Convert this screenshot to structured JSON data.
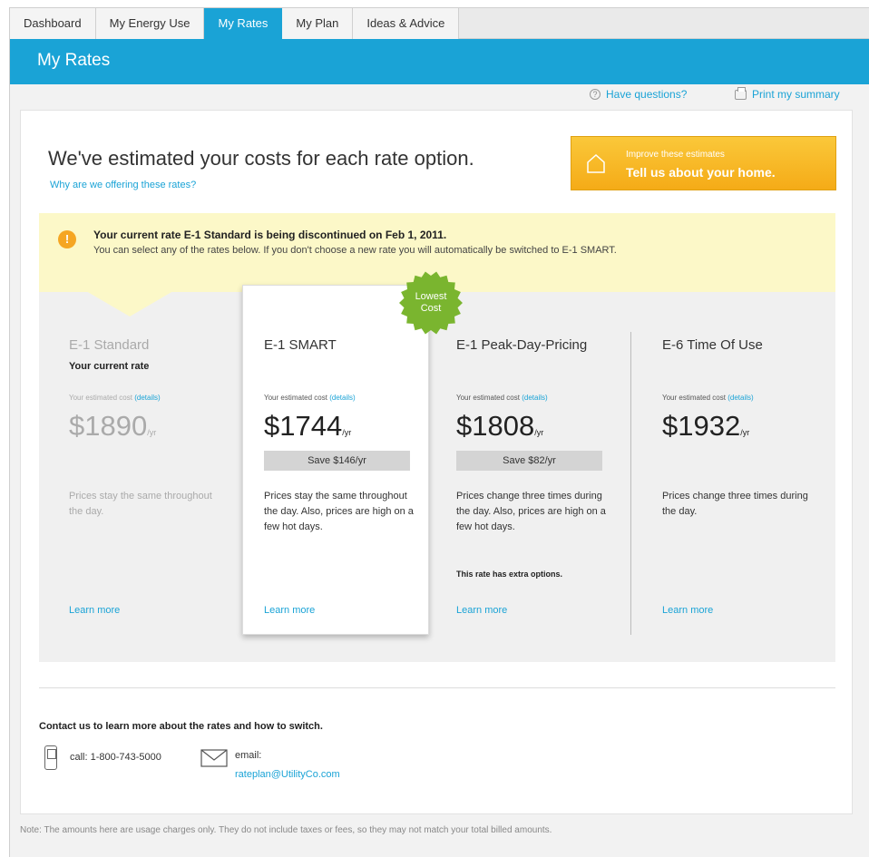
{
  "tabs": [
    {
      "label": "Dashboard"
    },
    {
      "label": "My Energy Use"
    },
    {
      "label": "My Rates"
    },
    {
      "label": "My Plan"
    },
    {
      "label": "Ideas & Advice"
    }
  ],
  "active_tab": "My Rates",
  "page_title": "My Rates",
  "top_links": {
    "questions": "Have questions?",
    "print": "Print my summary"
  },
  "headline": "We've estimated your costs for each rate option.",
  "why_link": "Why are we offering these rates?",
  "improve": {
    "small": "Improve these estimates",
    "big": "Tell us about your home."
  },
  "alert": {
    "title": "Your current rate E-1 Standard is being discontinued on Feb 1, 2011.",
    "body": "You can select any of the rates below. If you don't choose a new rate you will automatically be switched to E-1 SMART."
  },
  "badge": {
    "line1": "Lowest",
    "line2": "Cost"
  },
  "rates": [
    {
      "name": "E-1 Standard",
      "current": "Your current rate",
      "est_label": "Your estimated cost",
      "details": "(details)",
      "price": "$1890",
      "unit": "/yr",
      "save": "",
      "desc": "Prices stay the same throughout the day.",
      "extra": "",
      "learn": "Learn more"
    },
    {
      "name": "E-1 SMART",
      "current": "",
      "est_label": "Your estimated cost",
      "details": "(details)",
      "price": "$1744",
      "unit": "/yr",
      "save": "Save $146/yr",
      "desc": "Prices stay the same throughout the day. Also, prices are high on a few hot days.",
      "extra": "",
      "learn": "Learn more"
    },
    {
      "name": "E-1 Peak-Day-Pricing",
      "current": "",
      "est_label": "Your estimated cost",
      "details": "(details)",
      "price": "$1808",
      "unit": "/yr",
      "save": "Save $82/yr",
      "desc": "Prices change three times during the day. Also, prices are high on a few hot days.",
      "extra": "This rate has extra options.",
      "learn": "Learn more"
    },
    {
      "name": "E-6 Time Of Use",
      "current": "",
      "est_label": "Your estimated cost",
      "details": "(details)",
      "price": "$1932",
      "unit": "/yr",
      "save": "",
      "desc": "Prices change three times during the day.",
      "extra": "",
      "learn": "Learn more"
    }
  ],
  "contact": {
    "heading": "Contact us to learn more about the rates and how to switch.",
    "call": "call: 1-800-743-5000",
    "email_label": "email:",
    "email": "rateplan@UtilityCo.com"
  },
  "note": "Note: The amounts here are usage charges only. They do not include taxes or fees, so they may not match your total billed amounts.",
  "colors": {
    "accent": "#1aa3d6",
    "improve": "#f8b91e",
    "alert_bg": "#fcf8c8",
    "badge": "#7ab52f"
  }
}
